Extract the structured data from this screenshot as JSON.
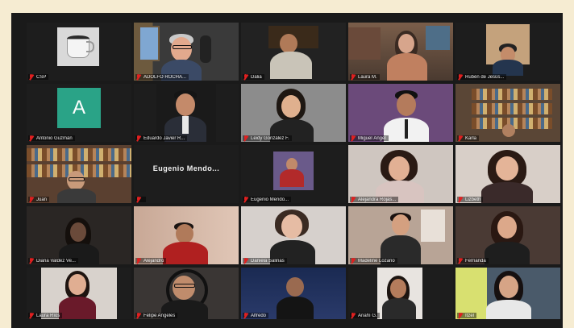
{
  "participants": [
    {
      "name": "CSP",
      "type": "mug"
    },
    {
      "name": "ADOLFO ROCHA...",
      "type": "video"
    },
    {
      "name": "Dalia",
      "type": "video"
    },
    {
      "name": "Laura M.",
      "type": "video"
    },
    {
      "name": "Rubén de Jesús...",
      "type": "video"
    },
    {
      "name": "Antonio Guzmán",
      "type": "avatar",
      "initial": "A",
      "avatar_color": "#2aa387"
    },
    {
      "name": "Eduardo Javier R...",
      "type": "video"
    },
    {
      "name": "Leidy González F.",
      "type": "video"
    },
    {
      "name": "Miguel Ángel",
      "type": "video"
    },
    {
      "name": "Karla",
      "type": "video"
    },
    {
      "name": "Juan",
      "type": "video"
    },
    {
      "name": "",
      "type": "name",
      "display_name": "Eugenio Mendo..."
    },
    {
      "name": "Eugenio Mendo...",
      "type": "video"
    },
    {
      "name": "Alejandra Rojas...",
      "type": "video"
    },
    {
      "name": "Lizbeth",
      "type": "video"
    },
    {
      "name": "Diana Valdez Ve...",
      "type": "video"
    },
    {
      "name": "Alejandro",
      "type": "video",
      "active": true
    },
    {
      "name": "Daniela Salinas",
      "type": "video"
    },
    {
      "name": "Madeline Lozano",
      "type": "video"
    },
    {
      "name": "Fernanda",
      "type": "video"
    },
    {
      "name": "Laura Ríos",
      "type": "video"
    },
    {
      "name": "Felipe Angeles",
      "type": "video"
    },
    {
      "name": "Alfredo",
      "type": "video"
    },
    {
      "name": "Anahí G.",
      "type": "video"
    },
    {
      "name": "Itzel",
      "type": "video"
    }
  ],
  "colors": {
    "frame": "#f6ecd2",
    "meeting_background": "#1a1a1a",
    "active_speaker_border": "#c8d84a",
    "mic_muted": "#e02020"
  },
  "icons": {
    "muted": "mic-off-icon"
  }
}
